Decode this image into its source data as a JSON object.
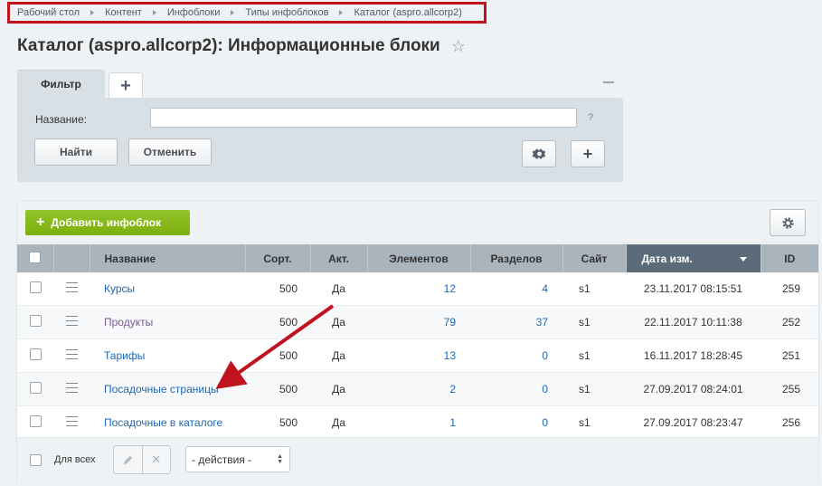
{
  "breadcrumb": [
    "Рабочий стол",
    "Контент",
    "Инфоблоки",
    "Типы инфоблоков",
    "Каталог (aspro.allcorp2)"
  ],
  "page_title": "Каталог (aspro.allcorp2): Информационные блоки",
  "filter": {
    "tab_label": "Фильтр",
    "name_label": "Название:",
    "name_value": "",
    "help": "?",
    "find_label": "Найти",
    "cancel_label": "Отменить"
  },
  "toolbar": {
    "add_label": "Добавить инфоблок"
  },
  "table": {
    "headers": [
      "Название",
      "Сорт.",
      "Акт.",
      "Элементов",
      "Разделов",
      "Сайт",
      "Дата изм.",
      "ID"
    ],
    "rows": [
      {
        "name": "Курсы",
        "sort": "500",
        "active": "Да",
        "elements": "12",
        "sections": "4",
        "site": "s1",
        "date": "23.11.2017 08:15:51",
        "id": "259"
      },
      {
        "name": "Продукты",
        "sort": "500",
        "active": "Да",
        "elements": "79",
        "sections": "37",
        "site": "s1",
        "date": "22.11.2017 10:11:38",
        "id": "252"
      },
      {
        "name": "Тарифы",
        "sort": "500",
        "active": "Да",
        "elements": "13",
        "sections": "0",
        "site": "s1",
        "date": "16.11.2017 18:28:45",
        "id": "251"
      },
      {
        "name": "Посадочные страницы",
        "sort": "500",
        "active": "Да",
        "elements": "2",
        "sections": "0",
        "site": "s1",
        "date": "27.09.2017 08:24:01",
        "id": "255"
      },
      {
        "name": "Посадочные в каталоге",
        "sort": "500",
        "active": "Да",
        "elements": "1",
        "sections": "0",
        "site": "s1",
        "date": "27.09.2017 08:23:47",
        "id": "256"
      }
    ]
  },
  "footer": {
    "select_all_label": "Для всех",
    "actions_label": "- действия -"
  },
  "annotations": {
    "highlight_color": "#c0121f"
  }
}
